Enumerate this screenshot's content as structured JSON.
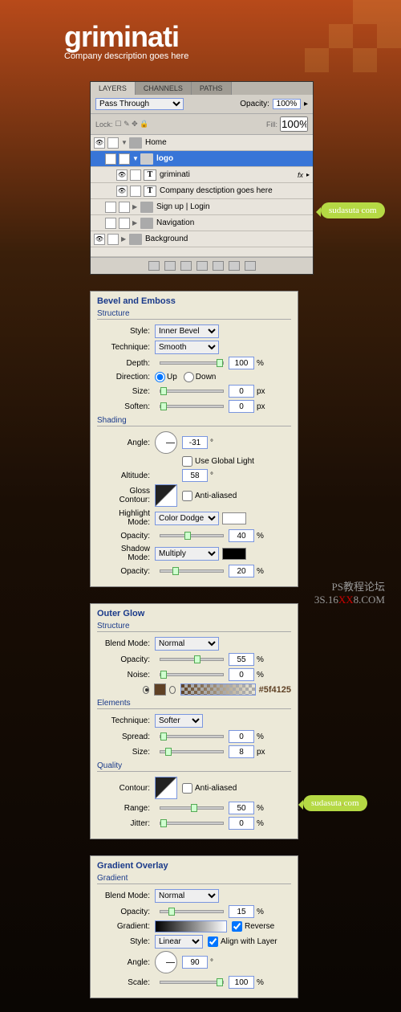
{
  "logo": {
    "text": "griminati",
    "tagline": "Company description goes here"
  },
  "layers": {
    "tabs": [
      "LAYERS",
      "CHANNELS",
      "PATHS"
    ],
    "blend_mode": "Pass Through",
    "opacity_label": "Opacity:",
    "opacity_value": "100%",
    "lock_label": "Lock:",
    "fill_label": "Fill:",
    "fill_value": "100%",
    "items": [
      {
        "name": "Home"
      },
      {
        "name": "logo"
      },
      {
        "name": "griminati",
        "fx": "fx"
      },
      {
        "name": "Company desctiption goes here"
      },
      {
        "name": "Sign up  |  Login"
      },
      {
        "name": "Navigation"
      },
      {
        "name": "Background"
      }
    ]
  },
  "bubble": {
    "site": "sudasuta",
    "dot": ".",
    "tld": "com"
  },
  "watermark": {
    "line1": "PS教程论坛",
    "line2a": "3S.16",
    "line2b": "XX",
    "line2c": "8.COM"
  },
  "bevel": {
    "title": "Bevel and Emboss",
    "structure_label": "Structure",
    "style_label": "Style:",
    "style_value": "Inner Bevel",
    "technique_label": "Technique:",
    "technique_value": "Smooth",
    "depth_label": "Depth:",
    "depth_value": "100",
    "depth_unit": "%",
    "direction_label": "Direction:",
    "up": "Up",
    "down": "Down",
    "size_label": "Size:",
    "size_value": "0",
    "size_unit": "px",
    "soften_label": "Soften:",
    "soften_value": "0",
    "soften_unit": "px",
    "shading_label": "Shading",
    "angle_label": "Angle:",
    "angle_value": "-31",
    "angle_unit": "°",
    "global_light": "Use Global Light",
    "altitude_label": "Altitude:",
    "altitude_value": "58",
    "altitude_unit": "°",
    "gloss_label": "Gloss Contour:",
    "antialiased": "Anti-aliased",
    "highlight_label": "Highlight Mode:",
    "highlight_value": "Color Dodge",
    "opacity_label": "Opacity:",
    "highlight_opacity": "40",
    "shadow_label": "Shadow Mode:",
    "shadow_value": "Multiply",
    "shadow_opacity": "20",
    "pct": "%"
  },
  "glow": {
    "title": "Outer Glow",
    "structure_label": "Structure",
    "blend_label": "Blend Mode:",
    "blend_value": "Normal",
    "opacity_label": "Opacity:",
    "opacity_value": "55",
    "pct": "%",
    "noise_label": "Noise:",
    "noise_value": "0",
    "color_hex": "#5f4125",
    "elements_label": "Elements",
    "technique_label": "Technique:",
    "technique_value": "Softer",
    "spread_label": "Spread:",
    "spread_value": "0",
    "size_label": "Size:",
    "size_value": "8",
    "px": "px",
    "quality_label": "Quality",
    "contour_label": "Contour:",
    "antialiased": "Anti-aliased",
    "range_label": "Range:",
    "range_value": "50",
    "jitter_label": "Jitter:",
    "jitter_value": "0"
  },
  "grad": {
    "title": "Gradient Overlay",
    "gradient_label": "Gradient",
    "blend_label": "Blend Mode:",
    "blend_value": "Normal",
    "opacity_label": "Opacity:",
    "opacity_value": "15",
    "pct": "%",
    "grad_field_label": "Gradient:",
    "reverse": "Reverse",
    "style_label": "Style:",
    "style_value": "Linear",
    "align": "Align with Layer",
    "angle_label": "Angle:",
    "angle_value": "90",
    "angle_unit": "°",
    "scale_label": "Scale:",
    "scale_value": "100"
  }
}
